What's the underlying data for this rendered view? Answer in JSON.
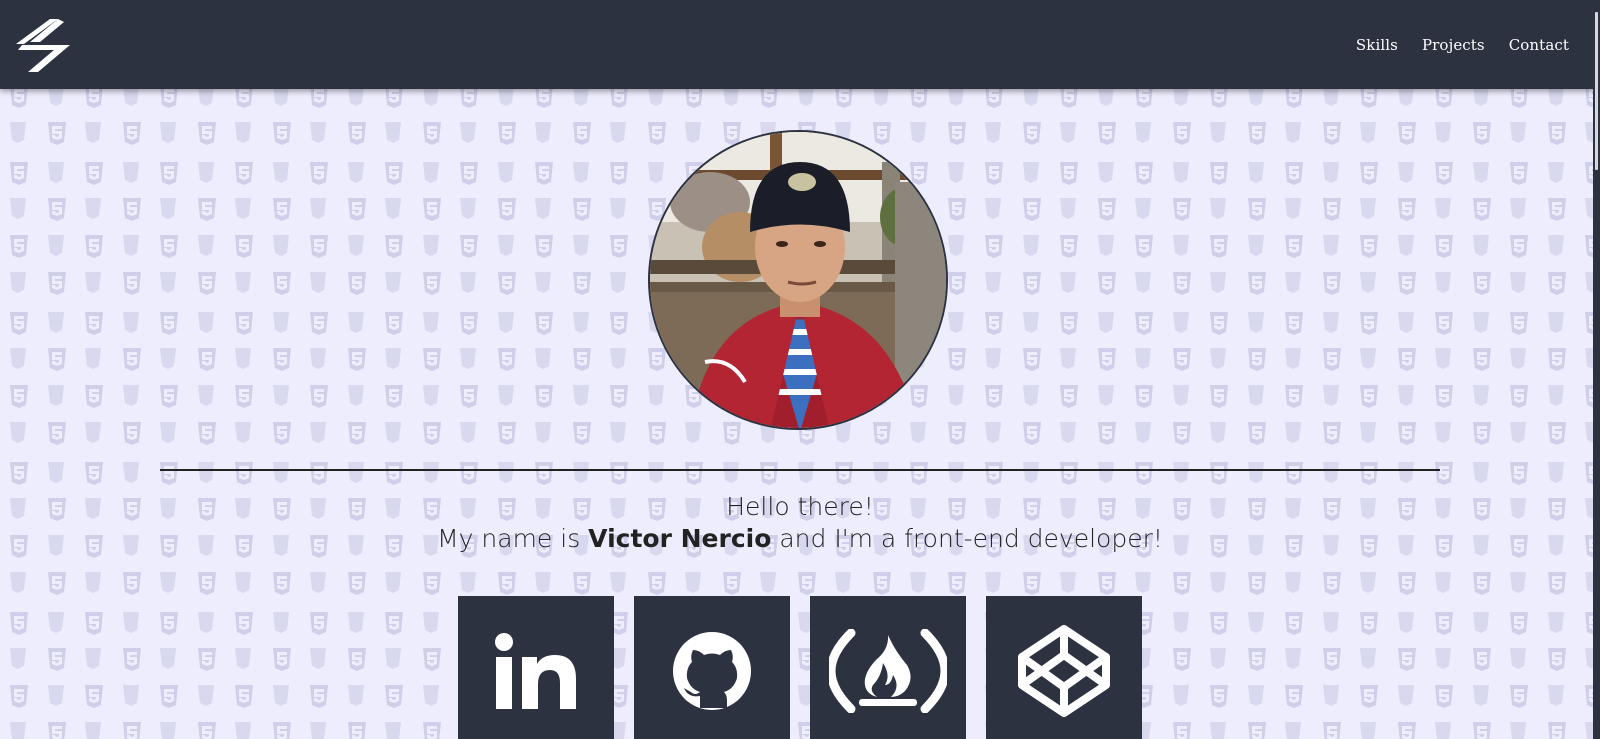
{
  "navbar": {
    "logo_icon": "lightning-logo-icon",
    "links": [
      {
        "label": "Skills"
      },
      {
        "label": "Projects"
      },
      {
        "label": "Contact"
      }
    ]
  },
  "hero": {
    "avatar_icon": "profile-photo",
    "greeting": "Hello there!",
    "intro_prefix": "My name is ",
    "name": "Victor Nercio",
    "intro_suffix": " and I'm a front-end developer!"
  },
  "socials": [
    {
      "icon": "linkedin-icon"
    },
    {
      "icon": "github-icon"
    },
    {
      "icon": "freecodecamp-icon"
    },
    {
      "icon": "codepen-icon"
    }
  ],
  "colors": {
    "navbar": "#2d3241",
    "background": "#eeedfd",
    "pattern": "#cbcbe6",
    "social_button": "#2d3241",
    "text": "#222222"
  }
}
